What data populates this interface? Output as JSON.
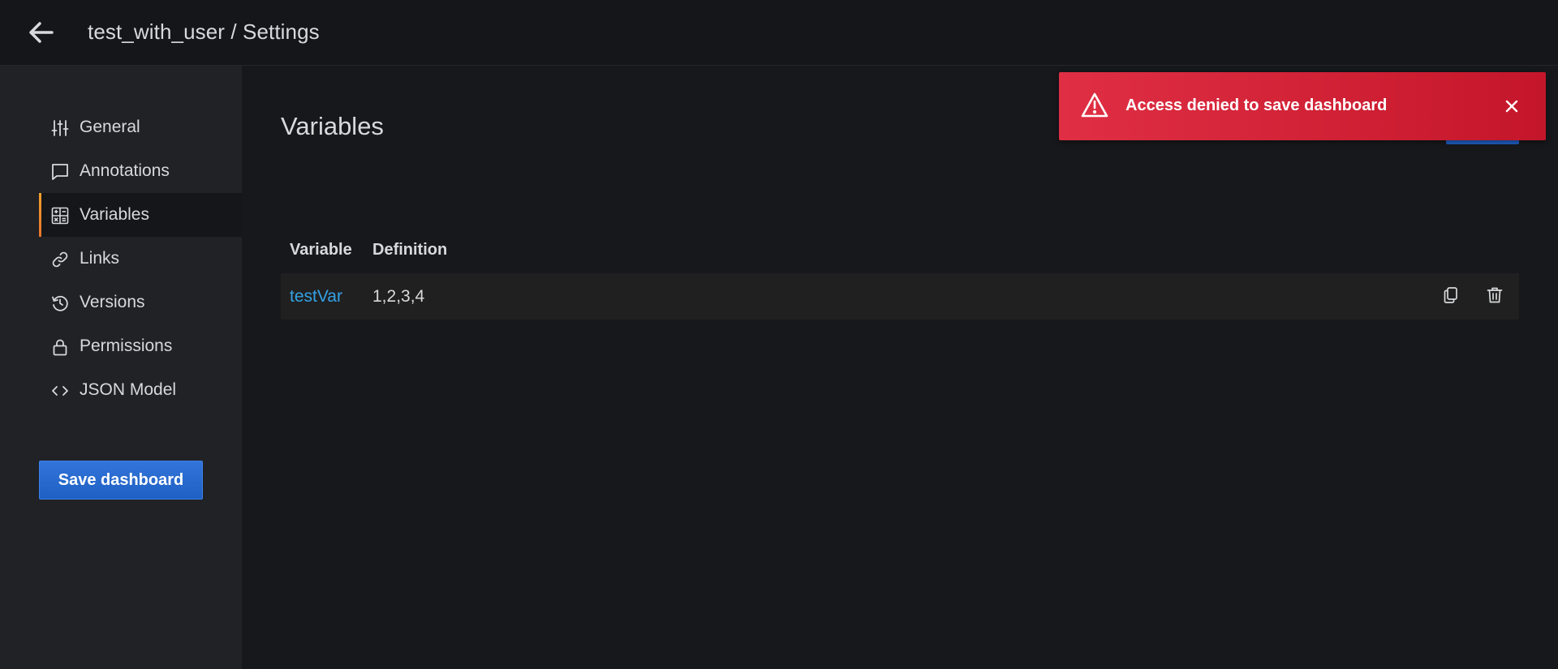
{
  "header": {
    "back_icon": "arrow-left-icon",
    "path": "test_with_user / Settings"
  },
  "sidebar": {
    "items": [
      {
        "label": "General",
        "icon": "sliders-icon"
      },
      {
        "label": "Annotations",
        "icon": "comment-icon"
      },
      {
        "label": "Variables",
        "icon": "calculator-icon",
        "active": true
      },
      {
        "label": "Links",
        "icon": "link-icon"
      },
      {
        "label": "Versions",
        "icon": "history-icon"
      },
      {
        "label": "Permissions",
        "icon": "lock-icon"
      },
      {
        "label": "JSON Model",
        "icon": "code-brackets-icon"
      }
    ],
    "save_label": "Save dashboard"
  },
  "main": {
    "title": "Variables",
    "table": {
      "headers": [
        "Variable",
        "Definition"
      ],
      "rows": [
        {
          "name": "testVar",
          "definition": "1,2,3,4",
          "actions": [
            "duplicate-icon",
            "trash-icon"
          ]
        }
      ]
    }
  },
  "toast": {
    "type": "error",
    "message": "Access denied to save dashboard",
    "icon": "warning-triangle-icon",
    "close_icon": "close-icon"
  },
  "colors": {
    "background": "#17181c",
    "sidebar": "#202226",
    "link": "#33a2e5",
    "primary": "#1f60c4",
    "error": "#e02f44",
    "active_indicator": "#f2a12b"
  }
}
